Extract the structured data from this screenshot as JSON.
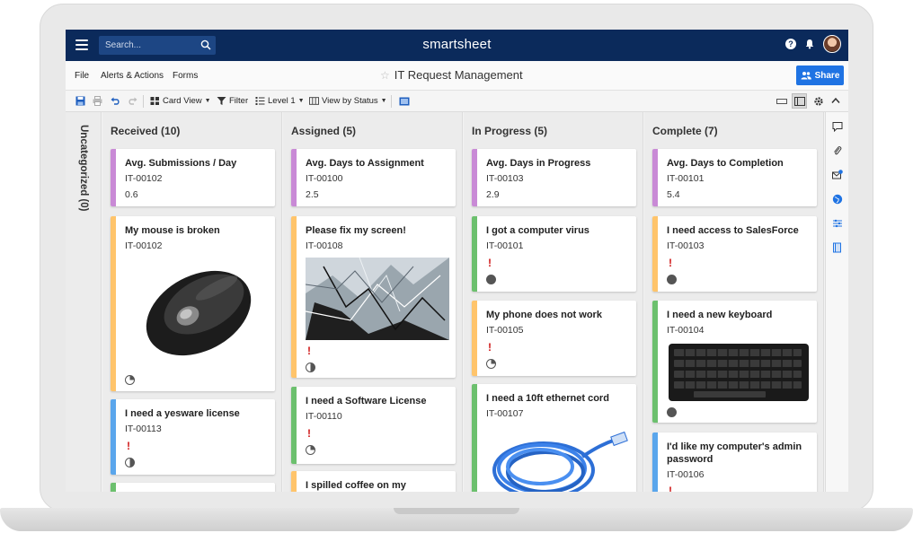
{
  "app": {
    "brand": "smartsheet",
    "search_placeholder": "Search...",
    "sheet_title": "IT Request Management",
    "share_label": "Share"
  },
  "menu": [
    "File",
    "Alerts & Actions",
    "Forms"
  ],
  "toolbar": {
    "card_view": "Card View",
    "filter": "Filter",
    "level": "Level 1",
    "view_by": "View by Status"
  },
  "uncategorized_label": "Uncategorized (0)",
  "colors": {
    "purple": "#c98ad6",
    "orange": "#ffc46b",
    "blue": "#5aa6ec",
    "green": "#6cc06e",
    "topbar": "#0b2a5b",
    "share": "#1f73e3"
  },
  "lanes": [
    {
      "title": "Received (10)",
      "cards": [
        {
          "title": "Avg. Submissions / Day",
          "id": "IT-00102",
          "value": "0.6",
          "color": "purple"
        },
        {
          "title": "My mouse is broken",
          "id": "IT-00102",
          "image": "computer-mouse",
          "status": "quarter",
          "color": "orange"
        },
        {
          "title": "I need a yesware license",
          "id": "IT-00113",
          "priority": "!",
          "status": "half",
          "color": "blue"
        }
      ]
    },
    {
      "title": "Assigned (5)",
      "cards": [
        {
          "title": "Avg. Days to Assignment",
          "id": "IT-00100",
          "value": "2.5",
          "color": "purple"
        },
        {
          "title": "Please fix my screen!",
          "id": "IT-00108",
          "image": "cracked-screen",
          "priority": "!",
          "status": "half",
          "color": "orange"
        },
        {
          "title": "I need a Software License",
          "id": "IT-00110",
          "priority": "!",
          "status": "quarter",
          "color": "green"
        },
        {
          "title": "I spilled coffee on my",
          "color": "orange"
        }
      ]
    },
    {
      "title": "In Progress (5)",
      "cards": [
        {
          "title": "Avg. Days in Progress",
          "id": "IT-00103",
          "value": "2.9",
          "color": "purple"
        },
        {
          "title": "I got a computer virus",
          "id": "IT-00101",
          "priority": "!",
          "status": "full",
          "color": "green"
        },
        {
          "title": "My phone does not work",
          "id": "IT-00105",
          "priority": "!",
          "status": "quarter",
          "color": "orange"
        },
        {
          "title": "I need a 10ft ethernet cord",
          "id": "IT-00107",
          "image": "ethernet-cable",
          "color": "green"
        }
      ]
    },
    {
      "title": "Complete (7)",
      "cards": [
        {
          "title": "Avg. Days to Completion",
          "id": "IT-00101",
          "value": "5.4",
          "color": "purple"
        },
        {
          "title": "I need access to SalesForce",
          "id": "IT-00103",
          "priority": "!",
          "status": "full",
          "color": "orange"
        },
        {
          "title": "I need a new keyboard",
          "id": "IT-00104",
          "image": "keyboard",
          "status": "full",
          "color": "green"
        },
        {
          "title": "I'd like my computer's admin password",
          "id": "IT-00106",
          "priority": "!",
          "color": "blue"
        }
      ]
    }
  ],
  "icons": [
    "hamburger-icon",
    "search-icon",
    "help-icon",
    "bell-icon",
    "avatar",
    "star-icon",
    "share-people-icon",
    "save-icon",
    "print-icon",
    "undo-icon",
    "redo-icon",
    "card-view-icon",
    "filter-icon",
    "level-icon",
    "view-by-icon",
    "image-icon",
    "panel-icon",
    "gear-icon",
    "collapse-icon",
    "comment-icon",
    "attachment-icon",
    "update-requests-icon",
    "publish-icon",
    "activity-icon",
    "summary-icon"
  ]
}
